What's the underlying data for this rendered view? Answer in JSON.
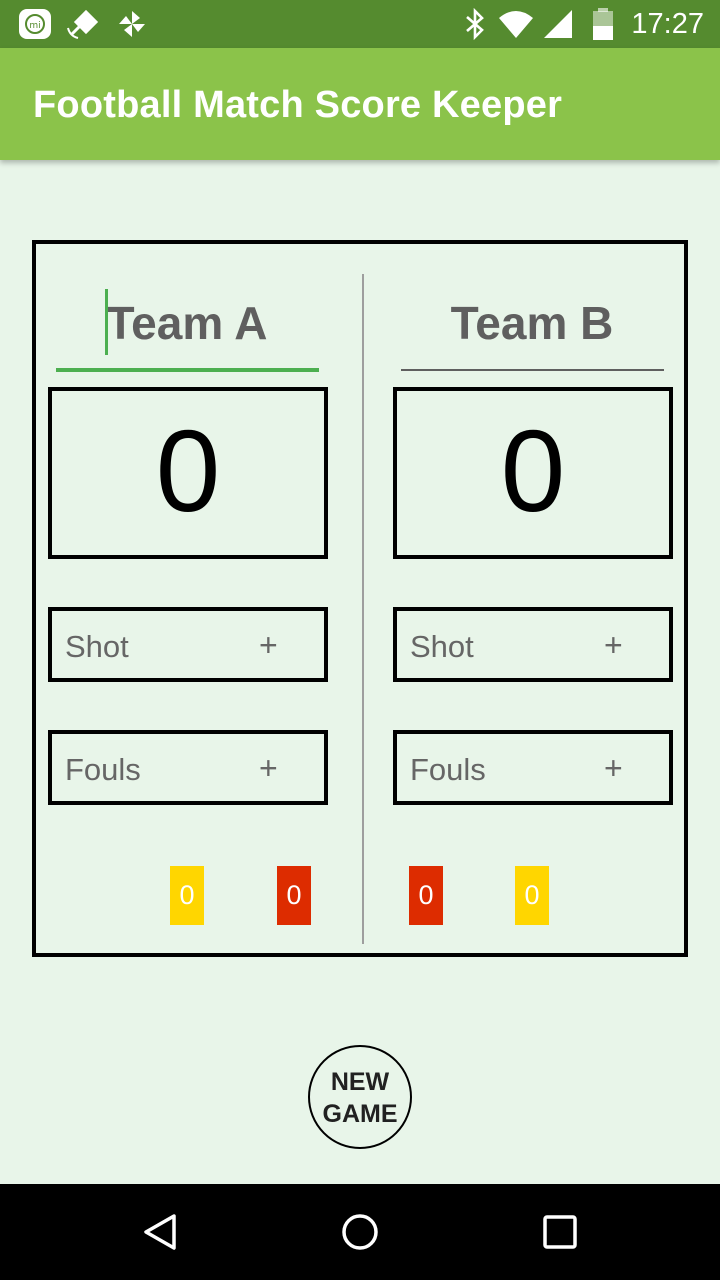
{
  "status_bar": {
    "time": "17:27",
    "left_icons": [
      "mi-app-icon",
      "satellite-icon",
      "pinwheel-icon"
    ],
    "right_icons": [
      "bluetooth-icon",
      "wifi-icon",
      "signal-icon",
      "battery-icon"
    ]
  },
  "app_bar": {
    "title": "Football Match Score Keeper"
  },
  "team_a": {
    "name": "Team A",
    "score": "0",
    "shot": {
      "label": "Shot",
      "plus": "+"
    },
    "fouls": {
      "label": "Fouls",
      "plus": "+"
    },
    "yellow_cards": "0",
    "red_cards": "0"
  },
  "team_b": {
    "name": "Team B",
    "score": "0",
    "shot": {
      "label": "Shot",
      "plus": "+"
    },
    "fouls": {
      "label": "Fouls",
      "plus": "+"
    },
    "red_cards": "0",
    "yellow_cards": "0"
  },
  "new_game": {
    "line1": "NEW",
    "line2": "GAME"
  },
  "colors": {
    "status_bar": "#558b2f",
    "app_bar": "#8bc34a",
    "background": "#e8f5e9",
    "accent": "#4caf50",
    "yellow_card": "#ffd600",
    "red_card": "#dd2c00"
  },
  "nav_bar": {
    "icons": [
      "back-icon",
      "home-icon",
      "recents-icon"
    ]
  }
}
